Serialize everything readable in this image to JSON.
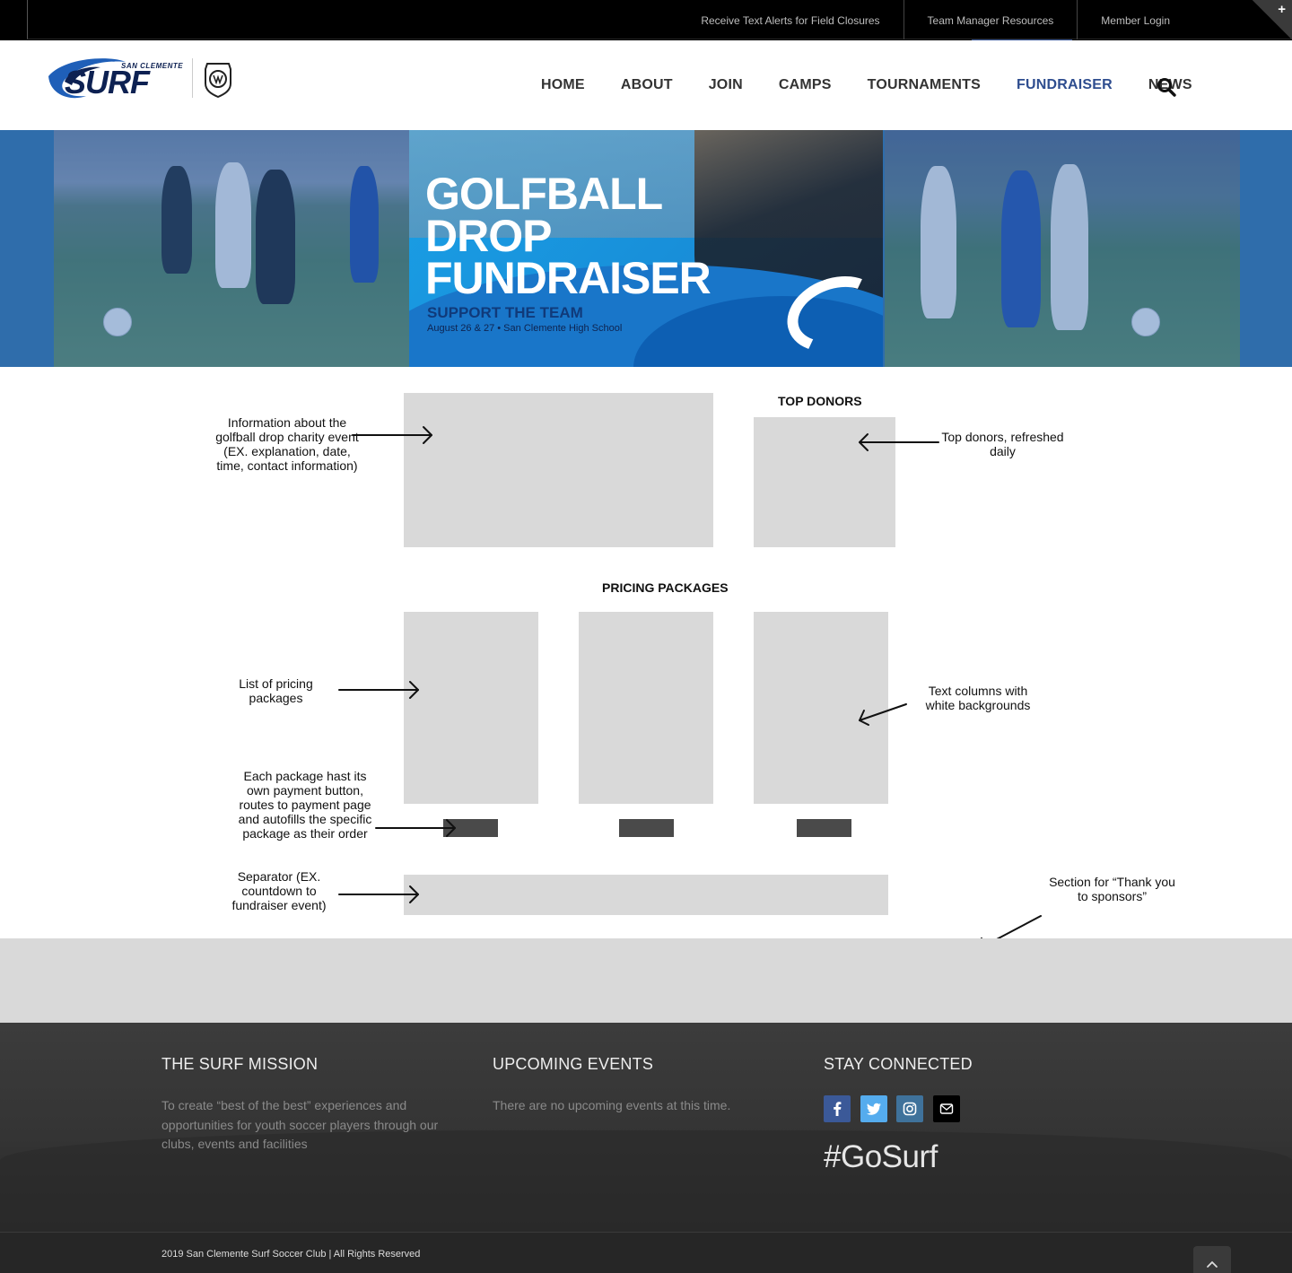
{
  "topbar": {
    "links": [
      "Receive Text Alerts for Field Closures",
      "Team Manager Resources",
      "Member Login"
    ],
    "toggle_symbol": "+"
  },
  "header": {
    "logo_small": "SAN CLEMENTE",
    "logo_main": "SURF",
    "nav": [
      "HOME",
      "ABOUT",
      "JOIN",
      "CAMPS",
      "TOURNAMENTS",
      "FUNDRAISER",
      "NEWS"
    ],
    "active_nav": "FUNDRAISER",
    "search_icon": "search-icon"
  },
  "hero": {
    "title_line1": "GOLFBALL",
    "title_line2": "DROP",
    "title_line3": "FUNDRAISER",
    "subtitle": "SUPPORT THE TEAM",
    "date_line": "August 26 & 27 • San Clemente High School"
  },
  "wireframe": {
    "top_donors_title": "TOP DONORS",
    "pricing_title": "PRICING PACKAGES",
    "notes": {
      "event_info": "Information about the golfball drop charity event (EX. explanation, date, time, contact information)",
      "top_donors": "Top donors, refreshed daily",
      "pricing_list": "List of pricing packages",
      "text_columns": "Text columns with white backgrounds",
      "payment_button": "Each package hast its own payment button, routes to payment page and autofills the specific package as their order",
      "separator": "Separator (EX. countdown to fundraiser event)",
      "sponsors": "Section for “Thank you to sponsors”"
    }
  },
  "footer": {
    "mission_title": "THE SURF MISSION",
    "mission_text": "To create “best of the best” experiences and opportunities for youth soccer players through our clubs, events and facilities",
    "events_title": "UPCOMING EVENTS",
    "events_text": "There are no upcoming events at this time.",
    "connected_title": "STAY CONNECTED",
    "social_icons": [
      "facebook-icon",
      "twitter-icon",
      "instagram-icon",
      "email-icon"
    ],
    "hashtag": "#GoSurf",
    "copyright": "2019 San Clemente Surf Soccer Club | All Rights Reserved"
  },
  "colors": {
    "brand_navy": "#0d2152",
    "nav_active": "#2e4d8f",
    "hero_blue": "#2f6dab",
    "placeholder_gray": "#d9d9d9",
    "footer_dark": "#353535"
  }
}
